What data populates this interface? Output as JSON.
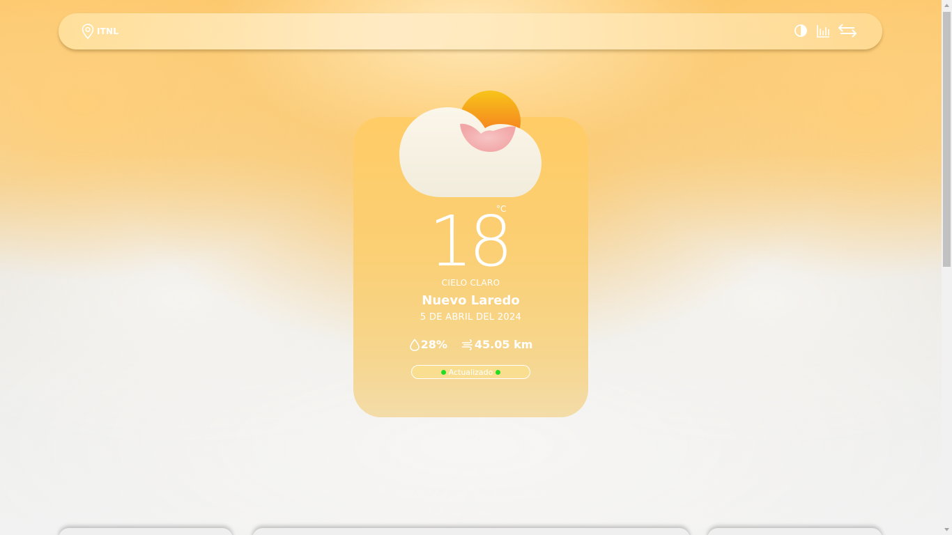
{
  "header": {
    "location_label": "ITNL",
    "icons": [
      "location-pin-icon",
      "contrast-icon",
      "chart-icon",
      "swap-icon"
    ]
  },
  "weather": {
    "temperature": "18",
    "unit": "°C",
    "condition": "CIELO CLARO",
    "city": "Nuevo Laredo",
    "date": "5 DE ABRIL DEL 2024",
    "humidity": "28%",
    "wind": "45.05 km",
    "status": "Actualizado",
    "icon": "cloud-sun-icon"
  },
  "colors": {
    "accent": "#ffcc66",
    "status_dot": "#22dd22",
    "text": "#ffffff"
  }
}
